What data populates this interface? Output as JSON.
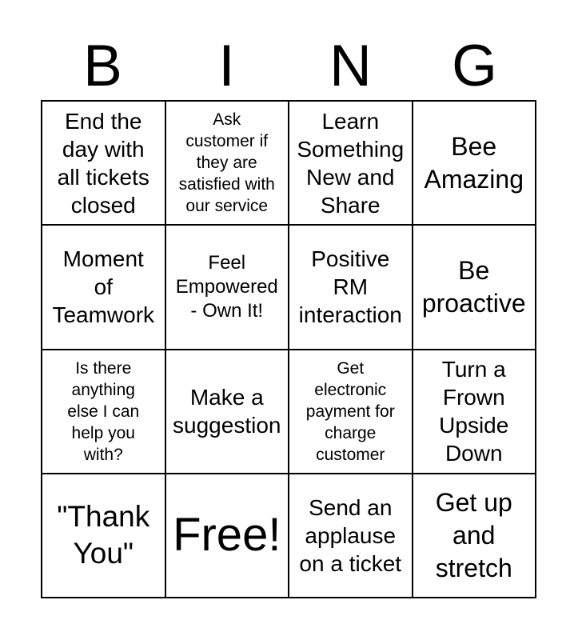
{
  "card": {
    "title_letters": [
      "B",
      "I",
      "N",
      "G"
    ],
    "columns": 4,
    "rows": 4,
    "border_color": "#000000",
    "background_color": "#ffffff",
    "text_color": "#000000",
    "cells": [
      {
        "text": "End the\nday with\nall tickets\nclosed",
        "size": "md",
        "row": 1,
        "col": 1,
        "free": false
      },
      {
        "text": "Ask\ncustomer if\nthey are\nsatisfied with\nour service",
        "size": "xs",
        "row": 1,
        "col": 2,
        "free": false
      },
      {
        "text": "Learn\nSomething\nNew and\nShare",
        "size": "md",
        "row": 1,
        "col": 3,
        "free": false
      },
      {
        "text": "Bee\nAmazing",
        "size": "lg",
        "row": 1,
        "col": 4,
        "free": false
      },
      {
        "text": "Moment\nof\nTeamwork",
        "size": "md",
        "row": 2,
        "col": 1,
        "free": false
      },
      {
        "text": "Feel\nEmpowered\n- Own It!",
        "size": "sm",
        "row": 2,
        "col": 2,
        "free": false
      },
      {
        "text": "Positive\nRM\ninteraction",
        "size": "md",
        "row": 2,
        "col": 3,
        "free": false
      },
      {
        "text": "Be\nproactive",
        "size": "lg",
        "row": 2,
        "col": 4,
        "free": false
      },
      {
        "text": "Is there\nanything\nelse I can\nhelp you\nwith?",
        "size": "xs",
        "row": 3,
        "col": 1,
        "free": false
      },
      {
        "text": "Make a\nsuggestion",
        "size": "md",
        "row": 3,
        "col": 2,
        "free": false
      },
      {
        "text": "Get\nelectronic\npayment for\ncharge\ncustomer",
        "size": "xs",
        "row": 3,
        "col": 3,
        "free": false
      },
      {
        "text": "Turn a\nFrown\nUpside\nDown",
        "size": "md",
        "row": 3,
        "col": 4,
        "free": false
      },
      {
        "text": "\"Thank\nYou\"",
        "size": "xl",
        "row": 4,
        "col": 1,
        "free": false
      },
      {
        "text": "Free!",
        "size": "xxl",
        "row": 4,
        "col": 2,
        "free": true
      },
      {
        "text": "Send an\napplause\non a ticket",
        "size": "md",
        "row": 4,
        "col": 2,
        "free": false
      },
      {
        "text": "Get up\nand\nstretch",
        "size": "lg",
        "row": 4,
        "col": 4,
        "free": false
      }
    ]
  }
}
